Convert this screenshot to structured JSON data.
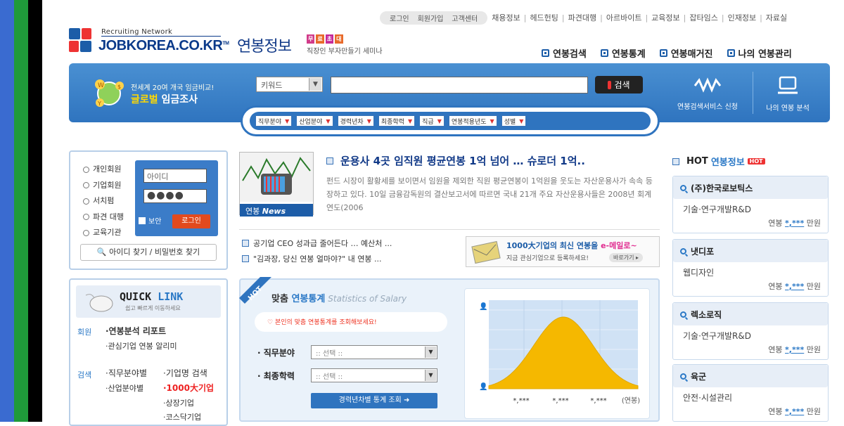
{
  "util_nav": {
    "pill": [
      "로그인",
      "회원가입",
      "고객센터"
    ],
    "links": [
      "채용정보",
      "헤드헌팅",
      "파견대행",
      "아르바이트",
      "교육정보",
      "잡타임스",
      "인재정보",
      "자료실"
    ]
  },
  "logo": {
    "tagline": "Recruiting Network",
    "name": "JOBKOREA.CO.KR",
    "tm": "TM"
  },
  "section_title": "연봉정보",
  "mini_banner": {
    "tags": [
      "무",
      "료",
      "초",
      "대"
    ],
    "text": "직장인 부자만들기 세미나"
  },
  "main_nav": [
    "연봉검색",
    "연봉통계",
    "연봉매거진",
    "나의 연봉관리"
  ],
  "banner": {
    "global_small": "전세계 20여 개국 임금비교!",
    "global_big_a": "글로벌",
    "global_big_b": " 임금조사",
    "search_select": "키워드",
    "search_button": "검색",
    "service_1": "연봉검색서비스 신청",
    "service_2": "나의 연봉 분석"
  },
  "filters": [
    "직무분야",
    "산업분야",
    "경력년차",
    "최종학력",
    "직급",
    "연봉적용년도",
    "성별"
  ],
  "login": {
    "radios": [
      "개인회원",
      "기업회원",
      "서치펌",
      "파견 대행",
      "교육기관"
    ],
    "id_placeholder": "아이디",
    "password_mask": "●●●●",
    "secure_label": "보안",
    "login_button": "로그인",
    "find_button": "아이디 찾기 / 비밀번호 찾기"
  },
  "quick_link": {
    "title_a": "QUICK ",
    "title_b": "LINK",
    "subtitle": "쉽고 빠르게 이동하세요",
    "member_label": "회원",
    "member_items": [
      "·연봉분석 리포트",
      "·관심기업 연봉 알리미"
    ],
    "search_label": "검색",
    "search_col1": [
      "·직무분야별",
      "·산업분야별"
    ],
    "search_col2": [
      "·기업명 검색",
      "·1000大기업",
      "·상장기업",
      "·코스닥기업"
    ]
  },
  "news": {
    "image_label_a": "연봉 ",
    "image_label_b": "News",
    "headline": "운용사 4곳 임직원 평균연봉 1억 넘어 … 슈로더 1억..",
    "body": "펀드 시장이 활황세를 보이면서 임원을 제외한 직원 평균연봉이 1억원을 웃도는 자산운용사가 속속 등장하고 있다. 10일 금융감독원의 결산보고서에 따르면 국내 21개 주요 자산운용사들은 2008년 회계연도(2006",
    "items": [
      "공기업 CEO 성과급 줄어든다 … 예산처 ...",
      "\"김과장, 당신 연봉 얼마야?\" 내 연봉 ..."
    ]
  },
  "ad": {
    "title_a": "1000大기업의 최신 연봉을 ",
    "title_b": "e-메일로~",
    "sub": "지금 관심기업으로 등록하세요!",
    "button": "바로가기 ▸"
  },
  "stats": {
    "hot": "HOT",
    "title_a": "맞춤 ",
    "title_b": "연봉통계",
    "title_en": "Statistics of Salary",
    "notice": "본인의 맞춤 연봉통계를 조회해보세요!",
    "field1_label": "직무분야",
    "field2_label": "최종학력",
    "select_placeholder": ":: 선택 ::",
    "button": "경력년차별 통계 조회"
  },
  "chart_data": {
    "type": "area",
    "x_tick_labels": [
      "*,***",
      "*,***",
      "*,***"
    ],
    "xlabel": "(연봉)",
    "curve": "bell",
    "fill": "#f5b800",
    "background": "#d0e2f5"
  },
  "hot_salary": {
    "title_a": "HOT ",
    "title_b": "연봉정보",
    "badge": "HOT",
    "salary_label": "연봉",
    "salary_value": "*,***",
    "salary_unit": "만원",
    "items": [
      {
        "company": "(주)한국로보틱스",
        "category": "기술·연구개발R&D"
      },
      {
        "company": "냇디포",
        "category": "웹디자인"
      },
      {
        "company": "렉소로직",
        "category": "기술·연구개발R&D"
      },
      {
        "company": "육군",
        "category": "안전·시설관리"
      }
    ]
  },
  "colors": {
    "brand_blue": "#2f74bf",
    "accent_red": "#e24a1e",
    "stripe_blue": "#3a6bd0",
    "stripe_green": "#1f9a3a"
  }
}
